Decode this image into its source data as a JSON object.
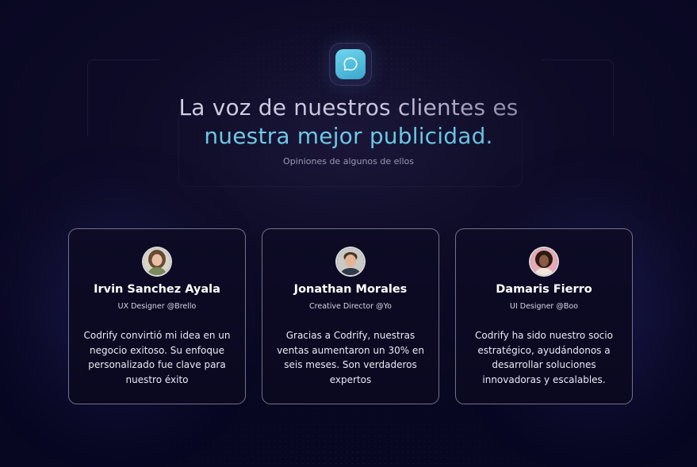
{
  "header": {
    "headline_line1": "La voz de nuestros clientes es",
    "headline_line2": "nuestra mejor publicidad.",
    "subtitle": "Opiniones de algunos de ellos",
    "icon": "chat-bubble-icon"
  },
  "testimonials": [
    {
      "name": "Irvin Sanchez Ayala",
      "role": "UX Designer @Brello",
      "quote": "Codrify convirtió mi idea en un negocio exitoso. Su enfoque personalizado fue clave para nuestro éxito",
      "avatar": "avatar-woman-curly-hair"
    },
    {
      "name": "Jonathan Morales",
      "role": "Creative Director @Yo",
      "quote": "Gracias a Codrify, nuestras ventas aumentaron un 30% en seis meses. Son verdaderos expertos",
      "avatar": "avatar-man-smiling"
    },
    {
      "name": "Damaris Fierro",
      "role": "UI Designer @Boo",
      "quote": "Codrify ha sido nuestro socio estratégico, ayudándonos a desarrollar soluciones innovadoras y escalables.",
      "avatar": "avatar-woman-curly-pink-bg"
    }
  ],
  "colors": {
    "background": "#0a0920",
    "accent": "#6bc8e6",
    "card_border": "#c8c8e1"
  }
}
